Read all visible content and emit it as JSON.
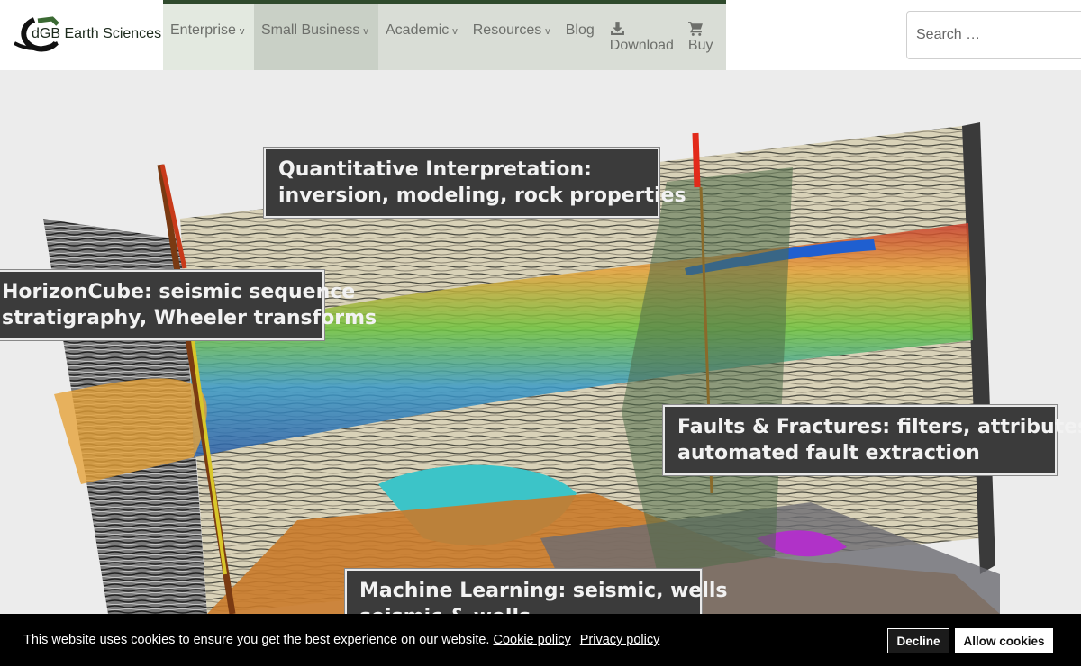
{
  "brand": {
    "name": "dGB Earth Sciences"
  },
  "nav": {
    "enterprise": "Enterprise",
    "small_business": "Small Business",
    "academic": "Academic",
    "resources": "Resources",
    "blog": "Blog",
    "download": "Download",
    "buy": "Buy",
    "caret": "v"
  },
  "search": {
    "placeholder": "Search …"
  },
  "hero": {
    "callouts": [
      {
        "line1": "Quantitative Interpretation:",
        "line2": "inversion, modeling, rock properties"
      },
      {
        "line1": "HorizonCube: seismic sequence",
        "line2": "stratigraphy, Wheeler transforms"
      },
      {
        "line1": "Faults & Fractures: filters, attributes,",
        "line2": "automated fault extraction"
      },
      {
        "line1": "Machine Learning: seismic, wells",
        "line2": "seismic & wells"
      }
    ]
  },
  "cookie": {
    "message": "This website uses cookies to ensure you get the best experience on our website.",
    "cookie_policy": "Cookie policy",
    "privacy_policy": "Privacy policy",
    "decline": "Decline",
    "allow": "Allow cookies"
  },
  "colors": {
    "nav_accent": "#2f4a2c",
    "cookie_bg": "#000000",
    "callout_bg": "#3b3b3b"
  }
}
